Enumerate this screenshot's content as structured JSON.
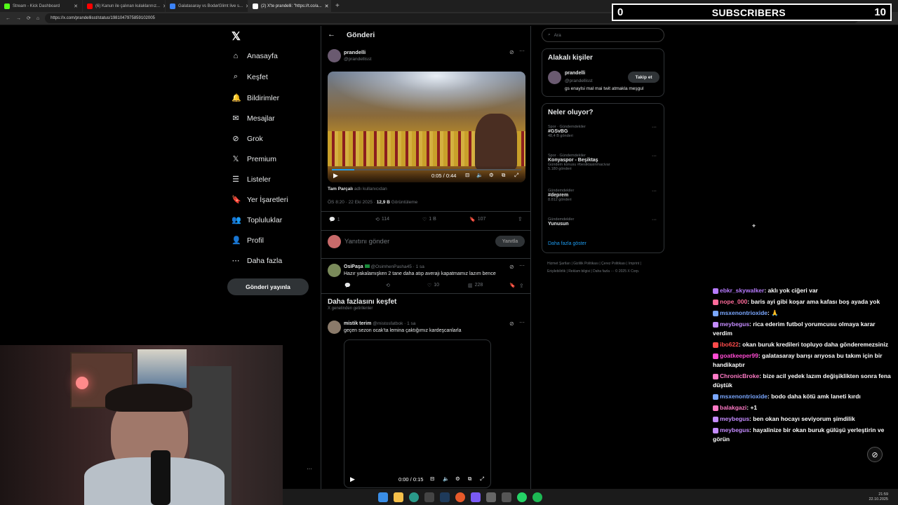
{
  "browser": {
    "tabs": [
      {
        "label": "Stream - Kick Dashboard",
        "color": "#53fc18"
      },
      {
        "label": "(6) Kanun ile çalınan kulaklarınız...",
        "color": "#ff0000"
      },
      {
        "label": "Galatasaray vs Bodø/Glimt live s...",
        "color": "#3b82f6"
      },
      {
        "label": "(2) X'te prandelli: \"https://t.co/a...",
        "color": "#ffffff"
      }
    ],
    "url": "https://x.com/prandellisst/status/1981047975859102005"
  },
  "overlay": {
    "subs_count": "0",
    "subs_label": "SUBSCRIBERS",
    "subs_goal": "10"
  },
  "nav": {
    "logo": "𝕏",
    "items": [
      {
        "label": "Anasayfa",
        "icon": "⌂"
      },
      {
        "label": "Keşfet",
        "icon": "⌕"
      },
      {
        "label": "Bildirimler",
        "icon": "🔔"
      },
      {
        "label": "Mesajlar",
        "icon": "✉"
      },
      {
        "label": "Grok",
        "icon": "⊘"
      },
      {
        "label": "Premium",
        "icon": "𝕏"
      },
      {
        "label": "Listeler",
        "icon": "☰"
      },
      {
        "label": "Yer İşaretleri",
        "icon": "🔖"
      },
      {
        "label": "Topluluklar",
        "icon": "👥"
      },
      {
        "label": "Profil",
        "icon": "👤"
      },
      {
        "label": "Daha fazla",
        "icon": "⋯"
      }
    ],
    "post_button": "Gönderi yayınla",
    "more": "···"
  },
  "main": {
    "back": "←",
    "header": "Gönderi",
    "post": {
      "name": "prandelli",
      "handle": "@prandellisst",
      "video_time": "0:05 / 0:44",
      "credit_bold": "Tam Parçalı",
      "credit_rest": " adlı kullanıcıdan",
      "time": "ÖS 8:20 · 22 Eki 2025 · ",
      "views_bold": "12,9 B",
      "views_rest": " Görüntüleme",
      "stats": {
        "reply": "1",
        "retweet": "114",
        "like": "1 B",
        "bookmark": "107"
      }
    },
    "reply_box": {
      "placeholder": "Yanıtını gönder",
      "button": "Yanıtla"
    },
    "reply": {
      "name": "OsiPaşa",
      "handle": "@OsimhenPasha45 · 1 sa",
      "text": "Hazır yakalamışken 2 tane daha atıp averajı kapatmamız lazım bence",
      "likes": "10",
      "views": "228"
    },
    "discover": {
      "title": "Daha fazlasını keşfet",
      "subtitle": "X genelinden getirilenler"
    },
    "post2": {
      "name": "mistik terim",
      "handle": "@mistosfatbok · 1 sa",
      "text": "geçen sezon ocak'ta lemina çaktığımız kardeşcanlarla",
      "video_time": "0:00 / 0:15"
    }
  },
  "right": {
    "search_placeholder": "Ara",
    "people_title": "Alakalı kişiler",
    "person": {
      "name": "prandelli",
      "handle": "@prandellisst",
      "bio": "gs enaylsi mal mai twit atmakla meşgul",
      "follow": "Takip et"
    },
    "trends_title": "Neler oluyor?",
    "trends": [
      {
        "cat": "Spor · Gündemdekiler",
        "title": "#GSvBG",
        "meta": "48,4 B gönderi",
        "extra": ""
      },
      {
        "cat": "Spor · Gündemdekiler",
        "title": "Konyaspor - Beşiktaş",
        "meta": "5.180 gönderi",
        "extra": "Gündem konusu #besiktasinmacivar"
      },
      {
        "cat": "Gündemdekiler",
        "title": "#deprem",
        "meta": "8.812 gönderi",
        "extra": ""
      },
      {
        "cat": "Gündemdekiler",
        "title": "Yunusun",
        "meta": "",
        "extra": ""
      }
    ],
    "show_more": "Daha fazla göster",
    "footer": "Hizmet Şartları | Gizlilik Politikası | Çerez Politikası | Imprint | Erişilebilirlik | Reklam bilgisi | Daha fazla ··· © 2025 X Corp."
  },
  "chat": [
    {
      "user": "ebkr_skywalker",
      "color": "#b77bff",
      "text": ": aklı yok ciğeri var"
    },
    {
      "user": "nope_000",
      "color": "#ff6b9a",
      "text": ": baris ayi gibi koşar ama kafası boş ayada yok"
    },
    {
      "user": "msxenontrioxide",
      "color": "#7aa7ff",
      "text": ": 🙏"
    },
    {
      "user": "meybegus",
      "color": "#c58cff",
      "text": ": rica ederim futbol yorumcusu olmaya karar verdim"
    },
    {
      "user": "ibo622",
      "color": "#ff4b4b",
      "text": ": okan buruk kredileri topluyo daha gönderemezsiniz"
    },
    {
      "user": "goatkeeper99",
      "color": "#ff4bd2",
      "text": ": galatasaray barışı arıyosa bu takım için bir handikaptır"
    },
    {
      "user": "ChronicBroke",
      "color": "#ff7ac6",
      "text": ": bize acil yedek lazım değişiklikten sonra fena düştük"
    },
    {
      "user": "msxenontrioxide",
      "color": "#7aa7ff",
      "text": ": bodo daha kötü amk laneti kırdı"
    },
    {
      "user": "balakgazi",
      "color": "#ff7ac6",
      "text": ": +1"
    },
    {
      "user": "meybegus",
      "color": "#c58cff",
      "text": ": ben okan hocayı seviyorum şimdilik"
    },
    {
      "user": "meybegus",
      "color": "#c58cff",
      "text": ": hayalinize bir okan buruk gülüşü yerleştirin ve görün"
    }
  ],
  "taskbar": {
    "time": "21:59",
    "date": "22.10.2025"
  }
}
